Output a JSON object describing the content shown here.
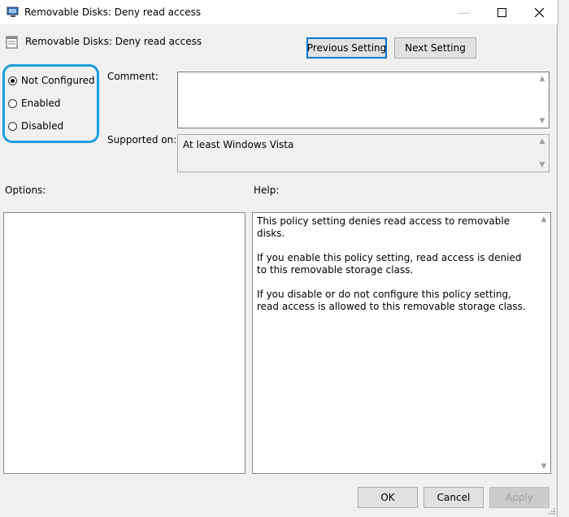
{
  "window": {
    "title": "Removable Disks: Deny read access"
  },
  "header": {
    "policy_name": "Removable Disks: Deny read access"
  },
  "nav": {
    "previous": "Previous Setting",
    "next": "Next Setting"
  },
  "state": {
    "options": [
      {
        "label": "Not Configured",
        "selected": true
      },
      {
        "label": "Enabled",
        "selected": false
      },
      {
        "label": "Disabled",
        "selected": false
      }
    ]
  },
  "comment": {
    "label": "Comment:",
    "value": ""
  },
  "supported": {
    "label": "Supported on:",
    "value": "At least Windows Vista"
  },
  "options_pane": {
    "label": "Options:"
  },
  "help_pane": {
    "label": "Help:",
    "paragraphs": [
      "This policy setting denies read access to removable disks.",
      "If you enable this policy setting, read access is denied to this removable storage class.",
      "If you disable or do not configure this policy setting, read access is allowed to this removable storage class."
    ]
  },
  "footer": {
    "ok": "OK",
    "cancel": "Cancel",
    "apply": "Apply"
  },
  "colors": {
    "highlight": "#1a9fdc",
    "focus": "#0078d7"
  }
}
